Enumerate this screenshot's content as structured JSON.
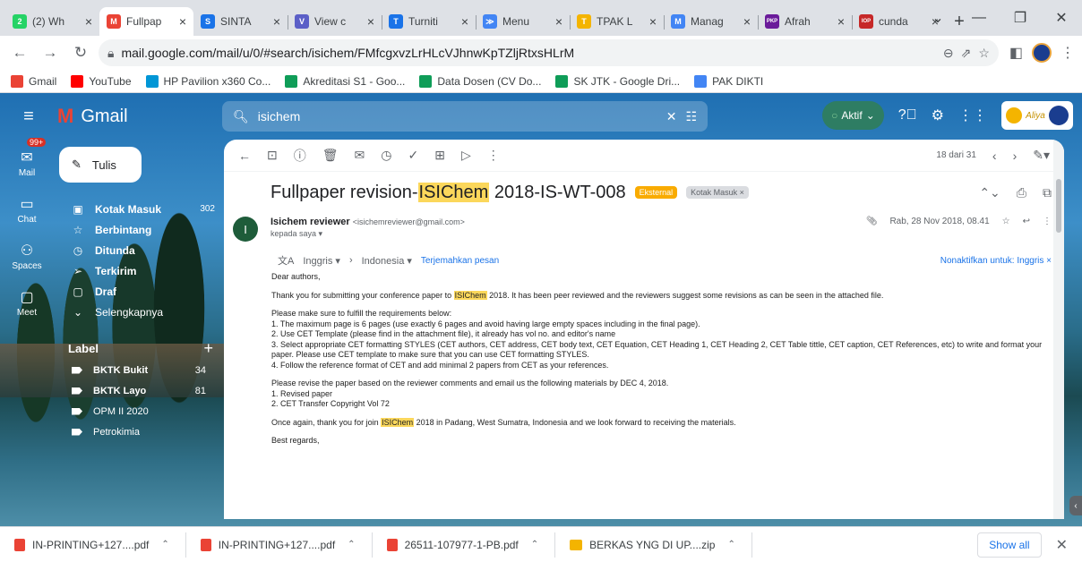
{
  "browser": {
    "tabs": [
      {
        "title": "(2) Wh",
        "color": "#25d366",
        "glyph": "2"
      },
      {
        "title": "Fullpap",
        "color": "#ea4335",
        "glyph": "M",
        "active": true
      },
      {
        "title": "SINTA",
        "color": "#1a73e8",
        "glyph": "S"
      },
      {
        "title": "View c",
        "color": "#5b5fc7",
        "glyph": "V"
      },
      {
        "title": "Turniti",
        "color": "#1a73e8",
        "glyph": "T"
      },
      {
        "title": "Menu",
        "color": "#4285f4",
        "glyph": "≫"
      },
      {
        "title": "TPAK L",
        "color": "#f4b400",
        "glyph": "T"
      },
      {
        "title": "Manag",
        "color": "#4285f4",
        "glyph": "M"
      },
      {
        "title": "Afrah",
        "color": "#6a1b9a",
        "glyph": "PKP"
      },
      {
        "title": "cunda",
        "color": "#c62828",
        "glyph": "IOP"
      }
    ],
    "url": "mail.google.com/mail/u/0/#search/isichem/FMfcgxvzLrHLcVJhnwKpTZljRtxsHLrM",
    "bookmarks": [
      {
        "label": "Gmail",
        "color": "#ea4335"
      },
      {
        "label": "YouTube",
        "color": "#ff0000"
      },
      {
        "label": "HP Pavilion x360 Co...",
        "color": "#0096d6"
      },
      {
        "label": "Akreditasi S1 - Goo...",
        "color": "#0f9d58"
      },
      {
        "label": "Data Dosen (CV Do...",
        "color": "#0f9d58"
      },
      {
        "label": "SK JTK - Google Dri...",
        "color": "#0f9d58"
      },
      {
        "label": "PAK DIKTI",
        "color": "#4285f4"
      }
    ]
  },
  "gmail": {
    "logo_text": "Gmail",
    "search_query": "isichem",
    "status": "Aktif",
    "rail": {
      "mail_badge": "99+",
      "items": [
        "Mail",
        "Chat",
        "Spaces",
        "Meet"
      ]
    },
    "compose_label": "Tulis",
    "nav": [
      {
        "label": "Kotak Masuk",
        "count": "302",
        "icon": "▣"
      },
      {
        "label": "Berbintang",
        "count": "",
        "icon": "☆"
      },
      {
        "label": "Ditunda",
        "count": "",
        "icon": "◷"
      },
      {
        "label": "Terkirim",
        "count": "",
        "icon": "➢"
      },
      {
        "label": "Draf",
        "count": "",
        "icon": "▢"
      },
      {
        "label": "Selengkapnya",
        "count": "",
        "icon": "⌄"
      }
    ],
    "label_header": "Label",
    "labels": [
      {
        "label": "BKTK Bukit",
        "count": "34"
      },
      {
        "label": "BKTK Layo",
        "count": "81"
      },
      {
        "label": "OPM II 2020",
        "count": ""
      },
      {
        "label": "Petrokimia",
        "count": ""
      }
    ],
    "toolbar_counter": "18 dari 31",
    "email": {
      "subject_before": "Fullpaper revision-",
      "subject_highlight": "ISIChem",
      "subject_after": " 2018-IS-WT-008",
      "tag_external": "Eksternal",
      "tag_inbox": "Kotak Masuk ×",
      "sender_name": "Isichem reviewer",
      "sender_email": "<isichemreviewer@gmail.com>",
      "to": "kepada saya ▾",
      "date": "Rab, 28 Nov 2018, 08.41",
      "avatar_letter": "I",
      "translate_from": "Inggris ▾",
      "translate_to": "Indonesia ▾",
      "translate_link": "Terjemahkan pesan",
      "translate_off": "Nonaktifkan untuk: Inggris ×",
      "greeting": "Dear authors,",
      "p1_before": "Thank you for submitting your conference paper to ",
      "p1_highlight": "ISIChem",
      "p1_after": " 2018. It has been peer reviewed and the reviewers suggest some revisions as can be seen in the attached file.",
      "req_intro": "Please make sure to fulfill the requirements below:",
      "req1": "1. The maximum page is 6 pages (use exactly 6 pages and avoid having large empty spaces including in the final page).",
      "req2": "2. Use CET Template (please find in the attachment file), it already has vol no. and editor's name",
      "req3": "3. Select appropriate CET formatting STYLES (CET authors, CET address, CET body text, CET Equation, CET Heading 1, CET Heading 2, CET Table tittle, CET caption, CET References, etc) to write and format your paper. Please use CET template to make sure that you can use CET formatting STYLES.",
      "req4": "4. Follow the reference format of CET and add minimal 2 papers from CET as your references.",
      "rev_intro": "Please revise the paper based on the reviewer comments and email us the following materials by DEC 4, 2018.",
      "rev1": "1. Revised paper",
      "rev2": "2. CET Transfer Copyright Vol 72",
      "p3_before": "Once again, thank you for join ",
      "p3_highlight": "ISIChem",
      "p3_after": " 2018 in Padang, West Sumatra, Indonesia and we look forward to receiving the materials.",
      "closing": "Best regards,"
    }
  },
  "downloads": {
    "items": [
      {
        "name": "IN-PRINTING+127....pdf",
        "kind": "pdf"
      },
      {
        "name": "IN-PRINTING+127....pdf",
        "kind": "pdf"
      },
      {
        "name": "26511-107977-1-PB.pdf",
        "kind": "pdf"
      },
      {
        "name": "BERKAS YNG DI UP....zip",
        "kind": "zip"
      }
    ],
    "show_all": "Show all"
  }
}
